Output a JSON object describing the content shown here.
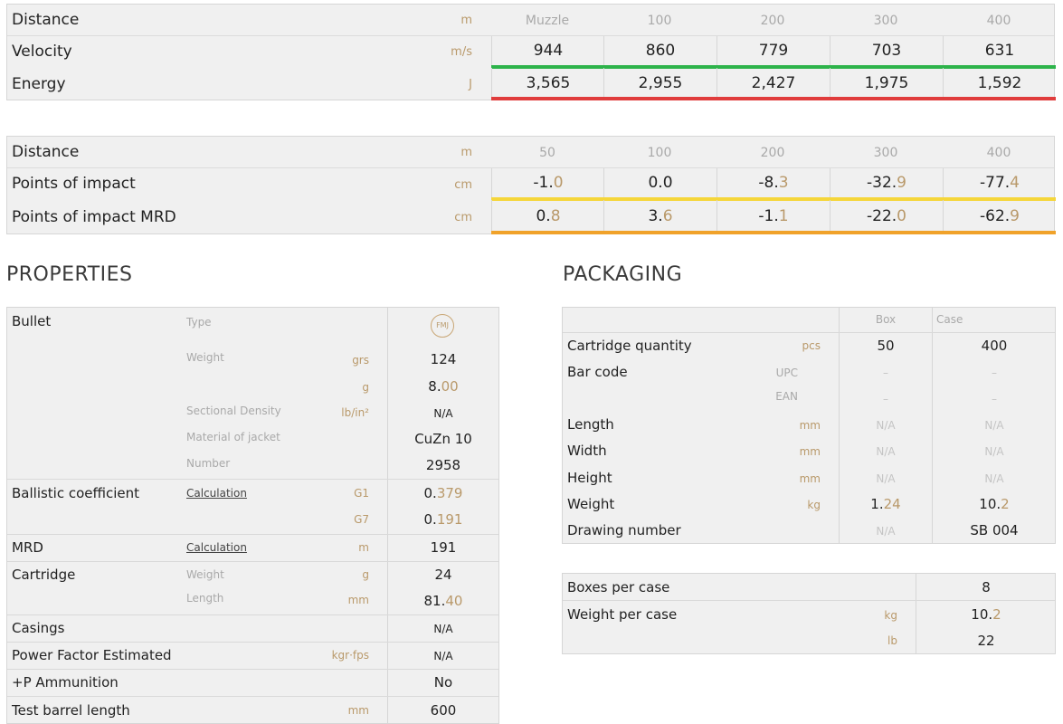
{
  "velocity_energy": {
    "distance_label": "Distance",
    "distance_unit": "m",
    "distances": [
      "Muzzle",
      "100",
      "200",
      "300",
      "400"
    ],
    "velocity_label": "Velocity",
    "velocity_unit": "m/s",
    "velocity": [
      "944",
      "860",
      "779",
      "703",
      "631"
    ],
    "energy_label": "Energy",
    "energy_unit": "J",
    "energy": [
      "3,565",
      "2,955",
      "2,427",
      "1,975",
      "1,592"
    ],
    "velocity_bar_color": "#2db34a",
    "energy_bar_color": "#e03c3c"
  },
  "impact": {
    "distance_label": "Distance",
    "distance_unit": "m",
    "distances": [
      "50",
      "100",
      "200",
      "300",
      "400"
    ],
    "poi_label": "Points of impact",
    "poi_unit": "cm",
    "poi": [
      {
        "int": "-1.",
        "dec": "0"
      },
      {
        "int": "0.",
        "dec": "0"
      },
      {
        "int": "-8.",
        "dec": "3"
      },
      {
        "int": "-32.",
        "dec": "9"
      },
      {
        "int": "-77.",
        "dec": "4"
      }
    ],
    "mrd_label": "Points of impact MRD",
    "mrd_unit": "cm",
    "mrd": [
      {
        "int": "0.",
        "dec": "8"
      },
      {
        "int": "3.",
        "dec": "6"
      },
      {
        "int": "-1.",
        "dec": "1"
      },
      {
        "int": "-22.",
        "dec": "0"
      },
      {
        "int": "-62.",
        "dec": "9"
      }
    ],
    "poi_bar_color": "#f5d63a",
    "mrd_bar_color": "#f0a22a"
  },
  "properties": {
    "title": "PROPERTIES",
    "bullet_label": "Bullet",
    "type_label": "Type",
    "type_badge": "FMJ",
    "weight_label": "Weight",
    "weight_unit_grs": "grs",
    "weight_grs": "124",
    "weight_unit_g": "g",
    "weight_g_int": "8.",
    "weight_g_dec": "00",
    "sd_label": "Sectional Density",
    "sd_unit": "lb/in²",
    "sd_value": "N/A",
    "jacket_label": "Material of jacket",
    "jacket_value": "CuZn 10",
    "number_label": "Number",
    "number_value": "2958",
    "bc_label": "Ballistic coefficient",
    "bc_calc": "Calculation",
    "g1_label": "G1",
    "g1_int": "0.",
    "g1_dec": "379",
    "g7_label": "G7",
    "g7_int": "0.",
    "g7_dec": "191",
    "mrd_label": "MRD",
    "mrd_calc": "Calculation",
    "mrd_unit": "m",
    "mrd_value": "191",
    "cartridge_label": "Cartridge",
    "cart_weight_label": "Weight",
    "cart_weight_unit": "g",
    "cart_weight_value": "24",
    "cart_length_label": "Length",
    "cart_length_unit": "mm",
    "cart_length_int": "81.",
    "cart_length_dec": "40",
    "casings_label": "Casings",
    "casings_value": "N/A",
    "pf_label": "Power Factor Estimated",
    "pf_unit": "kgr·fps",
    "pf_value": "N/A",
    "plusp_label": "+P Ammunition",
    "plusp_value": "No",
    "barrel_label": "Test barrel length",
    "barrel_unit": "mm",
    "barrel_value": "600"
  },
  "packaging": {
    "title": "PACKAGING",
    "col_box": "Box",
    "col_case": "Case",
    "qty_label": "Cartridge quantity",
    "qty_unit": "pcs",
    "qty_box": "50",
    "qty_case": "400",
    "barcode_label": "Bar code",
    "upc_label": "UPC",
    "ean_label": "EAN",
    "dash": "–",
    "length_label": "Length",
    "width_label": "Width",
    "height_label": "Height",
    "dim_unit": "mm",
    "na": "N/A",
    "weight_label": "Weight",
    "weight_unit": "kg",
    "weight_box_int": "1.",
    "weight_box_dec": "24",
    "weight_case_int": "10.",
    "weight_case_dec": "2",
    "drawing_label": "Drawing number",
    "drawing_box": "N/A",
    "drawing_case": "SB 004",
    "boxes_per_case_label": "Boxes per case",
    "boxes_per_case_value": "8",
    "weight_per_case_label": "Weight per case",
    "wpc_unit_kg": "kg",
    "wpc_kg_int": "10.",
    "wpc_kg_dec": "2",
    "wpc_unit_lb": "lb",
    "wpc_lb": "22"
  }
}
